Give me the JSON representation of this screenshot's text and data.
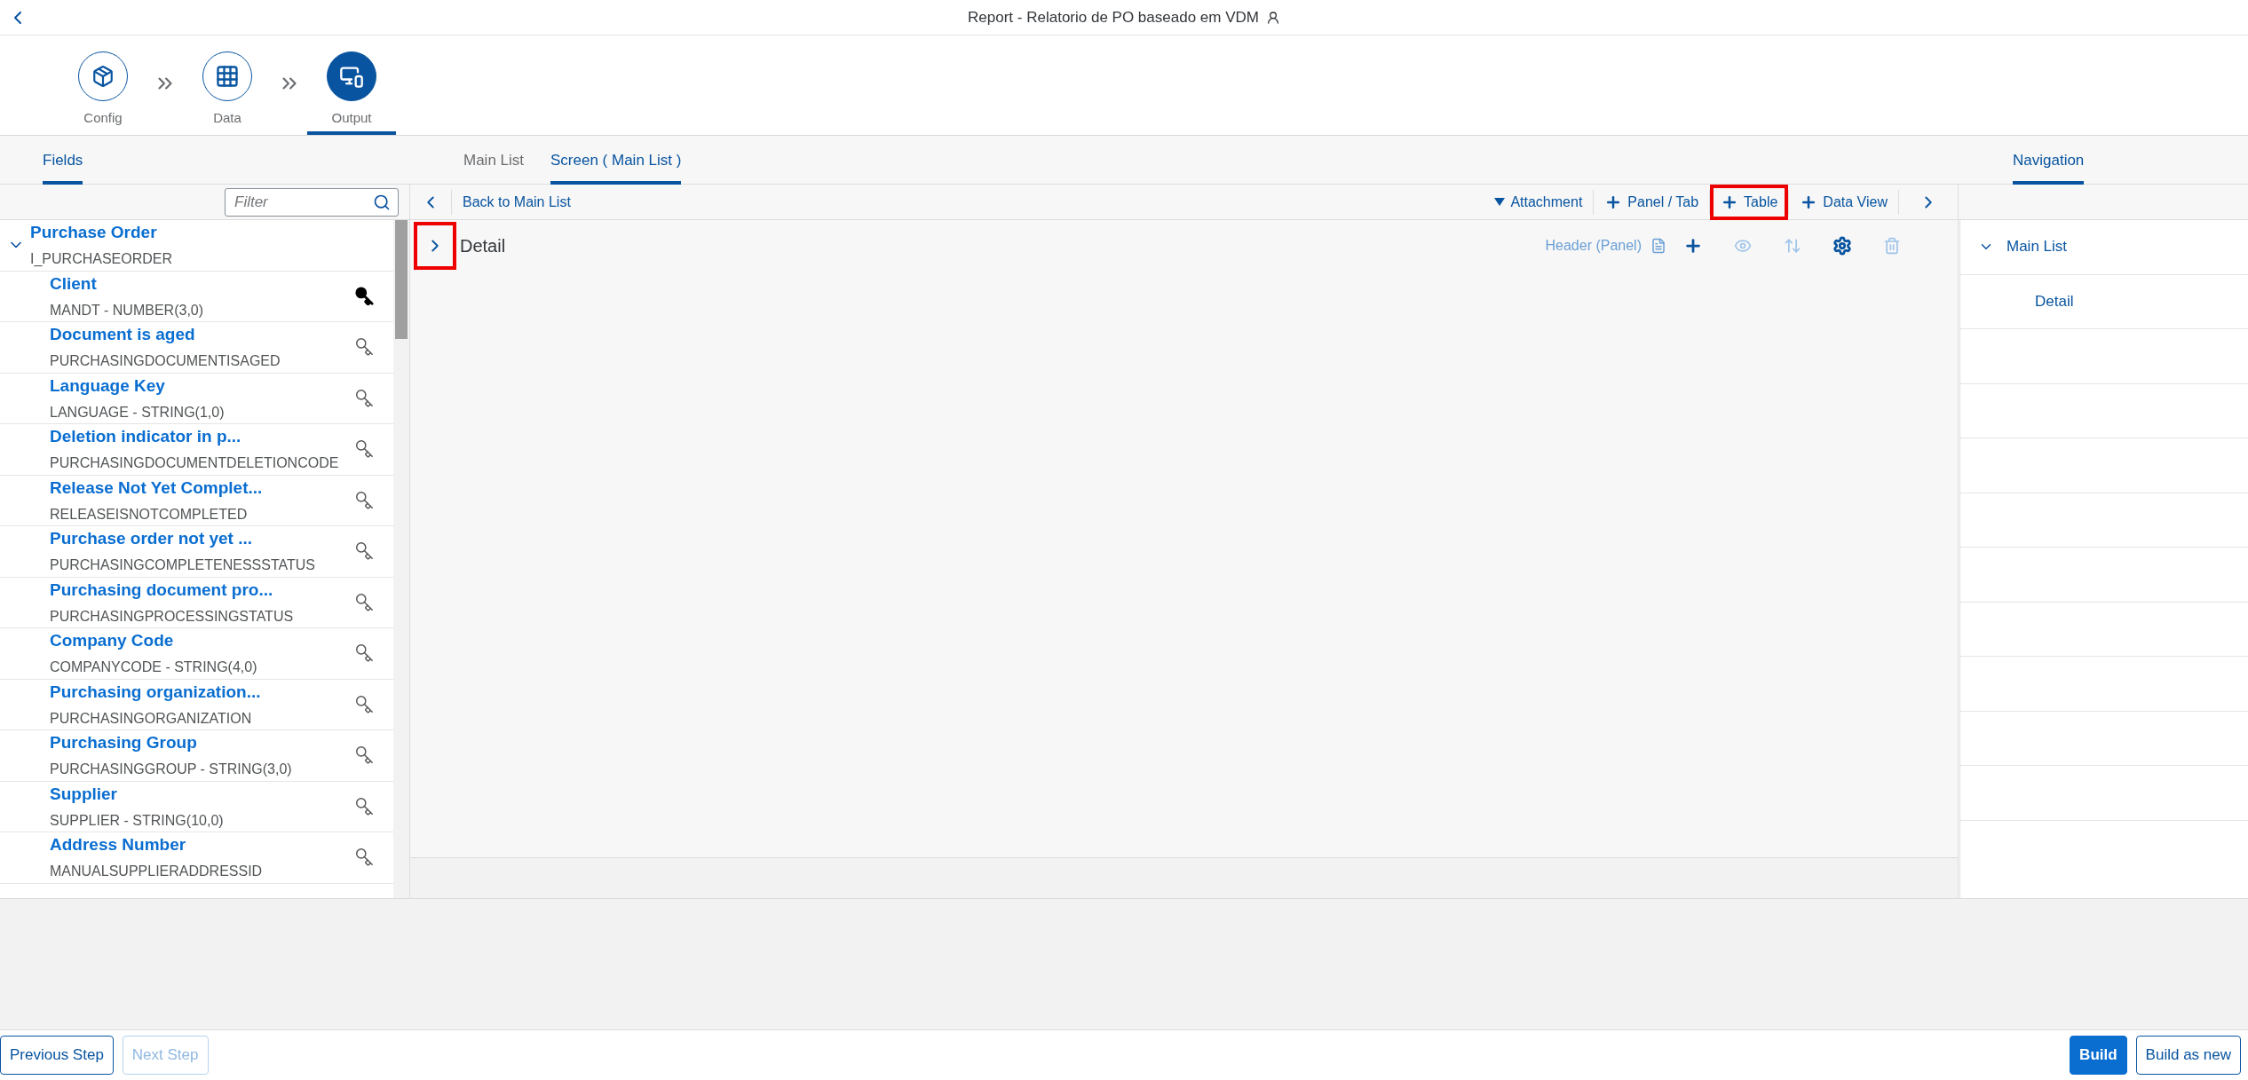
{
  "header": {
    "title": "Report - Relatorio de PO baseado em VDM"
  },
  "steps": [
    {
      "kind": "config",
      "label": "Config",
      "selected": false
    },
    {
      "kind": "data",
      "label": "Data",
      "selected": false
    },
    {
      "kind": "output",
      "label": "Output",
      "selected": true
    }
  ],
  "fields_tab": {
    "label": "Fields",
    "selected": true
  },
  "center_tabs": [
    {
      "label": "Main List",
      "selected": false
    },
    {
      "label": "Screen ( Main List )",
      "selected": true
    }
  ],
  "navigation_tab": {
    "label": "Navigation",
    "selected": true
  },
  "filter": {
    "placeholder": "Filter"
  },
  "tree": {
    "title": "Purchase Order",
    "subtitle": "I_PURCHASEORDER",
    "expanded": true,
    "children": [
      {
        "title": "Client",
        "subtitle": "MANDT - NUMBER(3,0)",
        "key": true
      },
      {
        "title": "Document is aged",
        "subtitle": "PURCHASINGDOCUMENTISAGED",
        "key": false
      },
      {
        "title": "Language Key",
        "subtitle": "LANGUAGE - STRING(1,0)",
        "key": false
      },
      {
        "title": "Deletion indicator in p...",
        "subtitle": "PURCHASINGDOCUMENTDELETIONCODE",
        "key": false
      },
      {
        "title": "Release Not Yet Complet...",
        "subtitle": "RELEASEISNOTCOMPLETED",
        "key": false
      },
      {
        "title": "Purchase order not yet ...",
        "subtitle": "PURCHASINGCOMPLETENESSSTATUS",
        "key": false
      },
      {
        "title": "Purchasing document pro...",
        "subtitle": "PURCHASINGPROCESSINGSTATUS",
        "key": false
      },
      {
        "title": "Company Code",
        "subtitle": "COMPANYCODE - STRING(4,0)",
        "key": false
      },
      {
        "title": "Purchasing organization...",
        "subtitle": "PURCHASINGORGANIZATION",
        "key": false
      },
      {
        "title": "Purchasing Group",
        "subtitle": "PURCHASINGGROUP - STRING(3,0)",
        "key": false
      },
      {
        "title": "Supplier",
        "subtitle": "SUPPLIER - STRING(10,0)",
        "key": false
      },
      {
        "title": "Address Number",
        "subtitle": "MANUALSUPPLIERADDRESSID",
        "key": false
      }
    ]
  },
  "toolbar": {
    "back_label": "Back to Main List",
    "actions": [
      {
        "kind": "menu",
        "label": "Attachment",
        "highlighted": false
      },
      {
        "kind": "add",
        "label": "Panel / Tab",
        "highlighted": false
      },
      {
        "kind": "add",
        "label": "Table",
        "highlighted": true
      },
      {
        "kind": "add",
        "label": "Data View",
        "highlighted": false
      }
    ]
  },
  "detail": {
    "title": "Detail",
    "expanded": false,
    "highlighted": true,
    "header_label": "Header (Panel)",
    "actions": [
      {
        "kind": "add",
        "disabled": false
      },
      {
        "kind": "view",
        "disabled": true
      },
      {
        "kind": "sort",
        "disabled": true
      },
      {
        "kind": "settings",
        "disabled": false
      },
      {
        "kind": "delete",
        "disabled": true
      }
    ]
  },
  "navigation": {
    "title": "Main List",
    "expanded": true,
    "children": [
      {
        "title": "Detail"
      }
    ]
  },
  "footer": {
    "left": [
      {
        "label": "Previous Step",
        "disabled": false
      },
      {
        "label": "Next Step",
        "disabled": true
      }
    ],
    "right": [
      {
        "label": "Build",
        "kind": "emphasized"
      },
      {
        "label": "Build as new",
        "kind": "default"
      }
    ]
  }
}
